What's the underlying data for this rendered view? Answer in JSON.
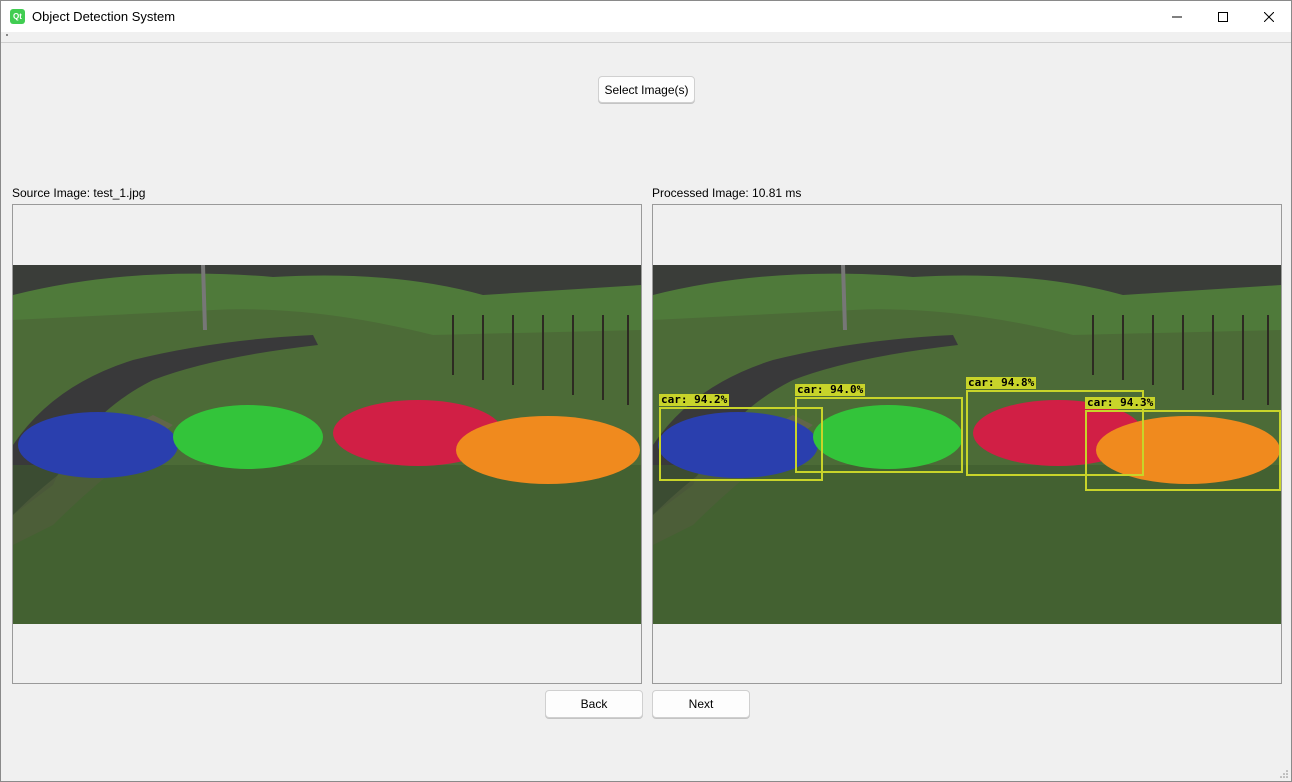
{
  "window": {
    "title": "Object Detection System",
    "app_icon_text": "Qt"
  },
  "toolbar": {
    "select_label": "Select Image(s)"
  },
  "source": {
    "label": "Source Image: test_1.jpg"
  },
  "processed": {
    "label": "Processed Image: 10.81 ms"
  },
  "detections": [
    {
      "label": "car: 94.2%"
    },
    {
      "label": "car: 94.0%"
    },
    {
      "label": "car: 94.8%"
    },
    {
      "label": "car: 94.3%"
    }
  ],
  "nav": {
    "back_label": "Back",
    "next_label": "Next"
  },
  "colors": {
    "detection_box": "#c8d42a",
    "car_blue": "#2a3fae",
    "car_green": "#33c43a",
    "car_red": "#d11f45",
    "car_orange": "#f08a1e"
  }
}
